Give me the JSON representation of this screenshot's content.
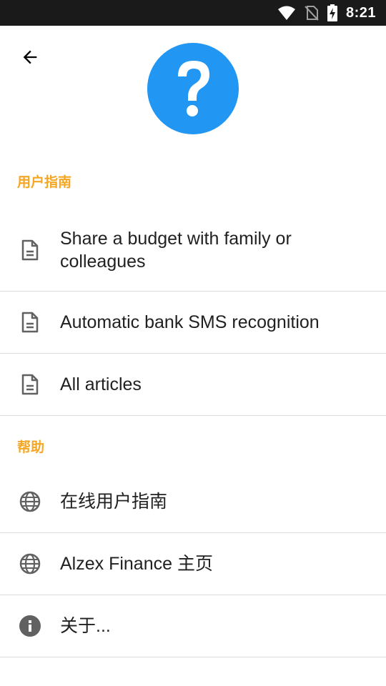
{
  "status_bar": {
    "time": "8:21",
    "icons": [
      "wifi-icon",
      "no-sim-icon",
      "battery-charging-icon"
    ]
  },
  "header": {
    "back_icon": "arrow-left-icon",
    "logo_icon": "question-mark-icon",
    "logo_color": "#2196f3"
  },
  "sections": {
    "user_guide": {
      "title": "用户指南",
      "items": [
        {
          "label": "Share a budget with family or colleagues",
          "icon": "document-icon"
        },
        {
          "label": "Automatic bank SMS recognition",
          "icon": "document-icon"
        },
        {
          "label": "All articles",
          "icon": "document-icon"
        }
      ]
    },
    "help": {
      "title": "帮助",
      "items": [
        {
          "label": "在线用户指南",
          "icon": "globe-icon"
        },
        {
          "label": "Alzex Finance 主页",
          "icon": "globe-icon"
        },
        {
          "label": "关于...",
          "icon": "info-icon"
        }
      ]
    }
  },
  "colors": {
    "accent": "#f5a623",
    "status_bar": "#1a1a1a",
    "icon_gray": "#616161"
  }
}
